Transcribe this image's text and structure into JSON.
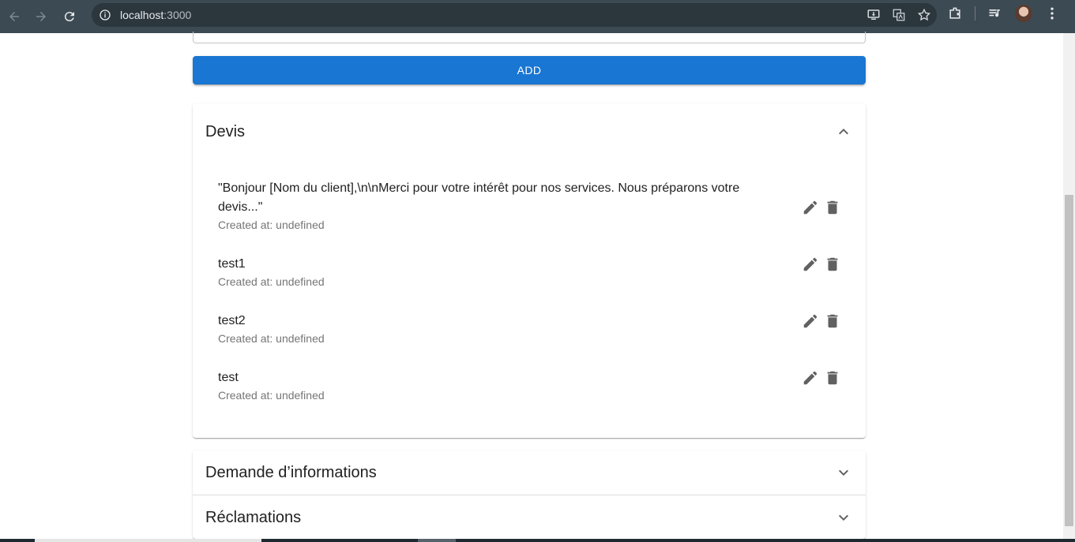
{
  "browser": {
    "url_host": "localhost",
    "url_port": ":3000"
  },
  "form": {
    "add_label": "ADD"
  },
  "sections": [
    {
      "title": "Devis",
      "expanded": true,
      "items": [
        {
          "text": "\"Bonjour [Nom du client],\\n\\nMerci pour votre intérêt pour nos services. Nous préparons votre devis...\"",
          "created": "Created at: undefined"
        },
        {
          "text": "test1",
          "created": "Created at: undefined"
        },
        {
          "text": "test2",
          "created": "Created at: undefined"
        },
        {
          "text": "test",
          "created": "Created at: undefined"
        }
      ]
    },
    {
      "title": "Demande d’informations",
      "expanded": false
    },
    {
      "title": "Réclamations",
      "expanded": false
    }
  ],
  "colors": {
    "primary": "#1976d2",
    "chrome_bg": "#3c4a53"
  }
}
